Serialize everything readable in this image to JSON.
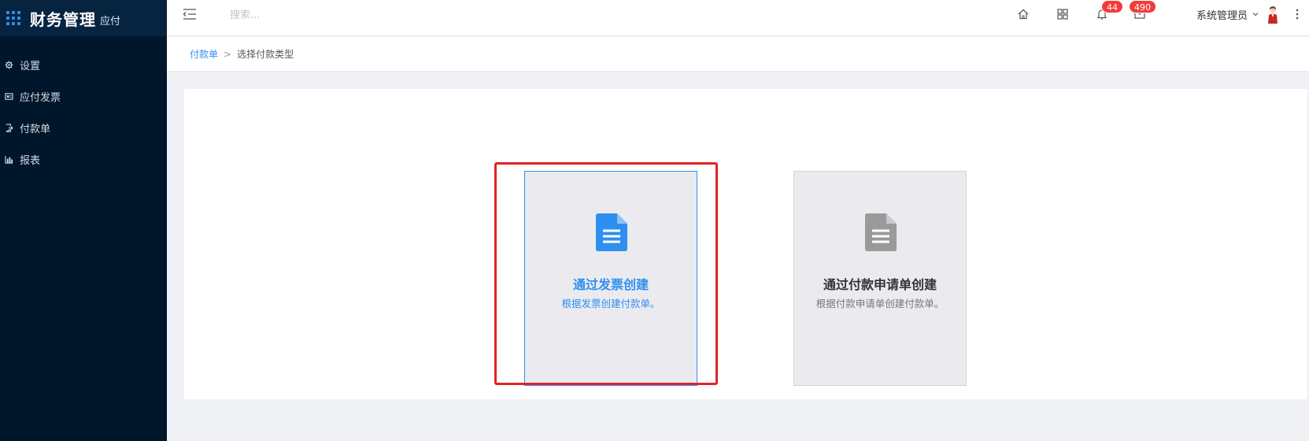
{
  "brand": {
    "title": "财务管理",
    "subtitle": "应付"
  },
  "sidebar": {
    "items": [
      {
        "label": "设置",
        "icon": "gear-icon"
      },
      {
        "label": "应付发票",
        "icon": "invoice-icon"
      },
      {
        "label": "付款单",
        "icon": "payment-doc-icon"
      },
      {
        "label": "报表",
        "icon": "bar-chart-icon"
      }
    ]
  },
  "header": {
    "search_placeholder": "搜索...",
    "notifications_count": "44",
    "messages_count": "490",
    "user_name": "系统管理员"
  },
  "breadcrumb": {
    "parent": "付款单",
    "separator": ">",
    "current": "选择付款类型"
  },
  "cards": [
    {
      "title": "通过发票创建",
      "description": "根据发票创建付款单。",
      "selected": true,
      "icon": "document-icon"
    },
    {
      "title": "通过付款申请单创建",
      "description": "根据付款申请单创建付款单。",
      "selected": false,
      "icon": "document-icon"
    }
  ],
  "colors": {
    "accent": "#2f8ff0",
    "sidebar": "#00162a",
    "highlight": "#e52222",
    "badge": "#f23c3c"
  }
}
